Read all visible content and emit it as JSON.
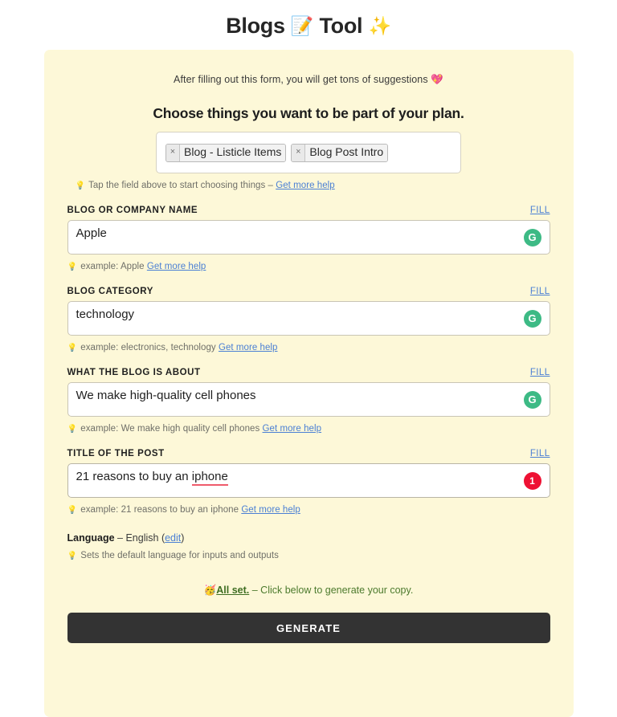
{
  "header": {
    "title_part1": "Blogs",
    "title_emoji1": "📝",
    "title_part2": "Tool",
    "title_emoji2": "✨"
  },
  "panel": {
    "intro": "After filling out this form, you will get tons of suggestions 💖",
    "section_heading": "Choose things you want to be part of your plan.",
    "chips": [
      {
        "remove": "×",
        "label": "Blog - Listicle Items"
      },
      {
        "remove": "×",
        "label": "Blog Post Intro"
      }
    ],
    "chips_hint_bulb": "💡",
    "chips_hint_text": "Tap the field above to start choosing things –",
    "chips_hint_link": "Get more help"
  },
  "fields": [
    {
      "label": "BLOG OR COMPANY NAME",
      "fill": "FILL",
      "value": "Apple",
      "adorn_type": "green",
      "adorn_glyph": "G",
      "hint_bulb": "💡",
      "hint_text": "example: Apple",
      "hint_link": "Get more help"
    },
    {
      "label": "BLOG CATEGORY",
      "fill": "FILL",
      "value": "technology",
      "adorn_type": "green",
      "adorn_glyph": "G",
      "hint_bulb": "💡",
      "hint_text": "example: electronics, technology",
      "hint_link": "Get more help"
    },
    {
      "label": "WHAT THE BLOG IS ABOUT",
      "fill": "FILL",
      "value": "We make high-quality cell phones",
      "adorn_type": "green",
      "adorn_glyph": "G",
      "hint_bulb": "💡",
      "hint_text": "example: We make high quality cell phones",
      "hint_link": "Get more help"
    },
    {
      "label": "TITLE OF THE POST",
      "fill": "FILL",
      "value_prefix": "21 reasons to buy an ",
      "value_misspelled": "iphone",
      "value": "21 reasons to buy an iphone",
      "adorn_type": "red",
      "adorn_glyph": "1",
      "hint_bulb": "💡",
      "hint_text": "example: 21 reasons to buy an iphone",
      "hint_link": "Get more help"
    }
  ],
  "language": {
    "label": "Language",
    "separator": " – ",
    "value": "English",
    "paren_open": "(",
    "edit_link": "edit",
    "paren_close": ")",
    "hint_bulb": "💡",
    "hint_text": "Sets the default language for inputs and outputs"
  },
  "footer": {
    "allset_emoji": "🥳",
    "allset_strong": "All set.",
    "allset_rest": " – Click below to generate your copy.",
    "generate_label": "GENERATE"
  },
  "colors": {
    "panel_bg": "#fdf8d8",
    "accent_green": "#3dba85",
    "accent_red": "#ee1133",
    "link_blue": "#4a7fd4",
    "button_dark": "#333333",
    "allset_green": "#4c7a2d"
  }
}
